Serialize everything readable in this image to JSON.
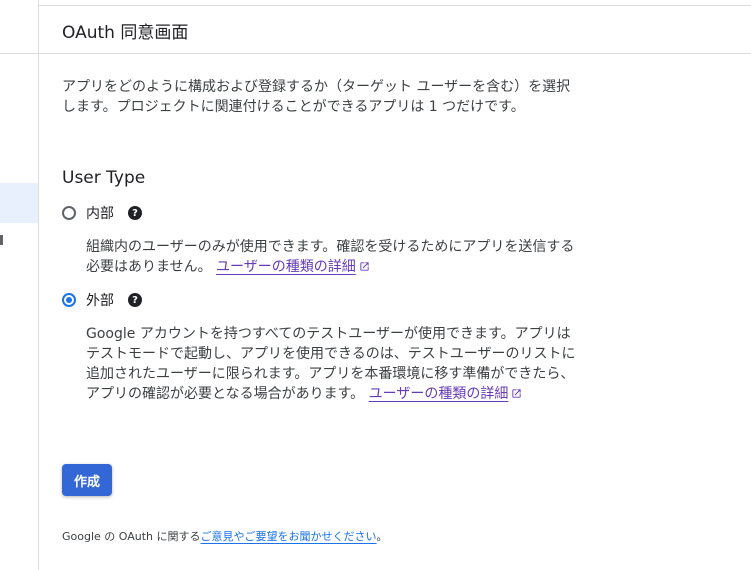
{
  "header": {
    "title": "OAuth 同意画面"
  },
  "description": "アプリをどのように構成および登録するか（ターゲット ユーザーを含む）を選択します。プロジェクトに関連付けることができるアプリは 1 つだけです。",
  "user_type": {
    "title": "User Type",
    "options": [
      {
        "label": "内部",
        "checked": false,
        "help_icon": "help-circle-icon",
        "description": "組織内のユーザーのみが使用できます。確認を受けるためにアプリを送信する必要はありません。",
        "link_text": "ユーザーの種類の詳細"
      },
      {
        "label": "外部",
        "checked": true,
        "help_icon": "help-circle-icon",
        "description": "Google アカウントを持つすべてのテストユーザーが使用できます。アプリはテストモードで起動し、アプリを使用できるのは、テストユーザーのリストに追加されたユーザーに限られます。アプリを本番環境に移す準備ができたら、アプリの確認が必要となる場合があります。",
        "link_text": "ユーザーの種類の詳細"
      }
    ]
  },
  "actions": {
    "create_label": "作成"
  },
  "feedback": {
    "prefix": "Google の OAuth に関する",
    "link_text": "ご意見やご要望をお聞かせください",
    "suffix": "。"
  },
  "colors": {
    "accent": "#1a73e8",
    "button": "#3367d6",
    "link": "#673ab7"
  }
}
